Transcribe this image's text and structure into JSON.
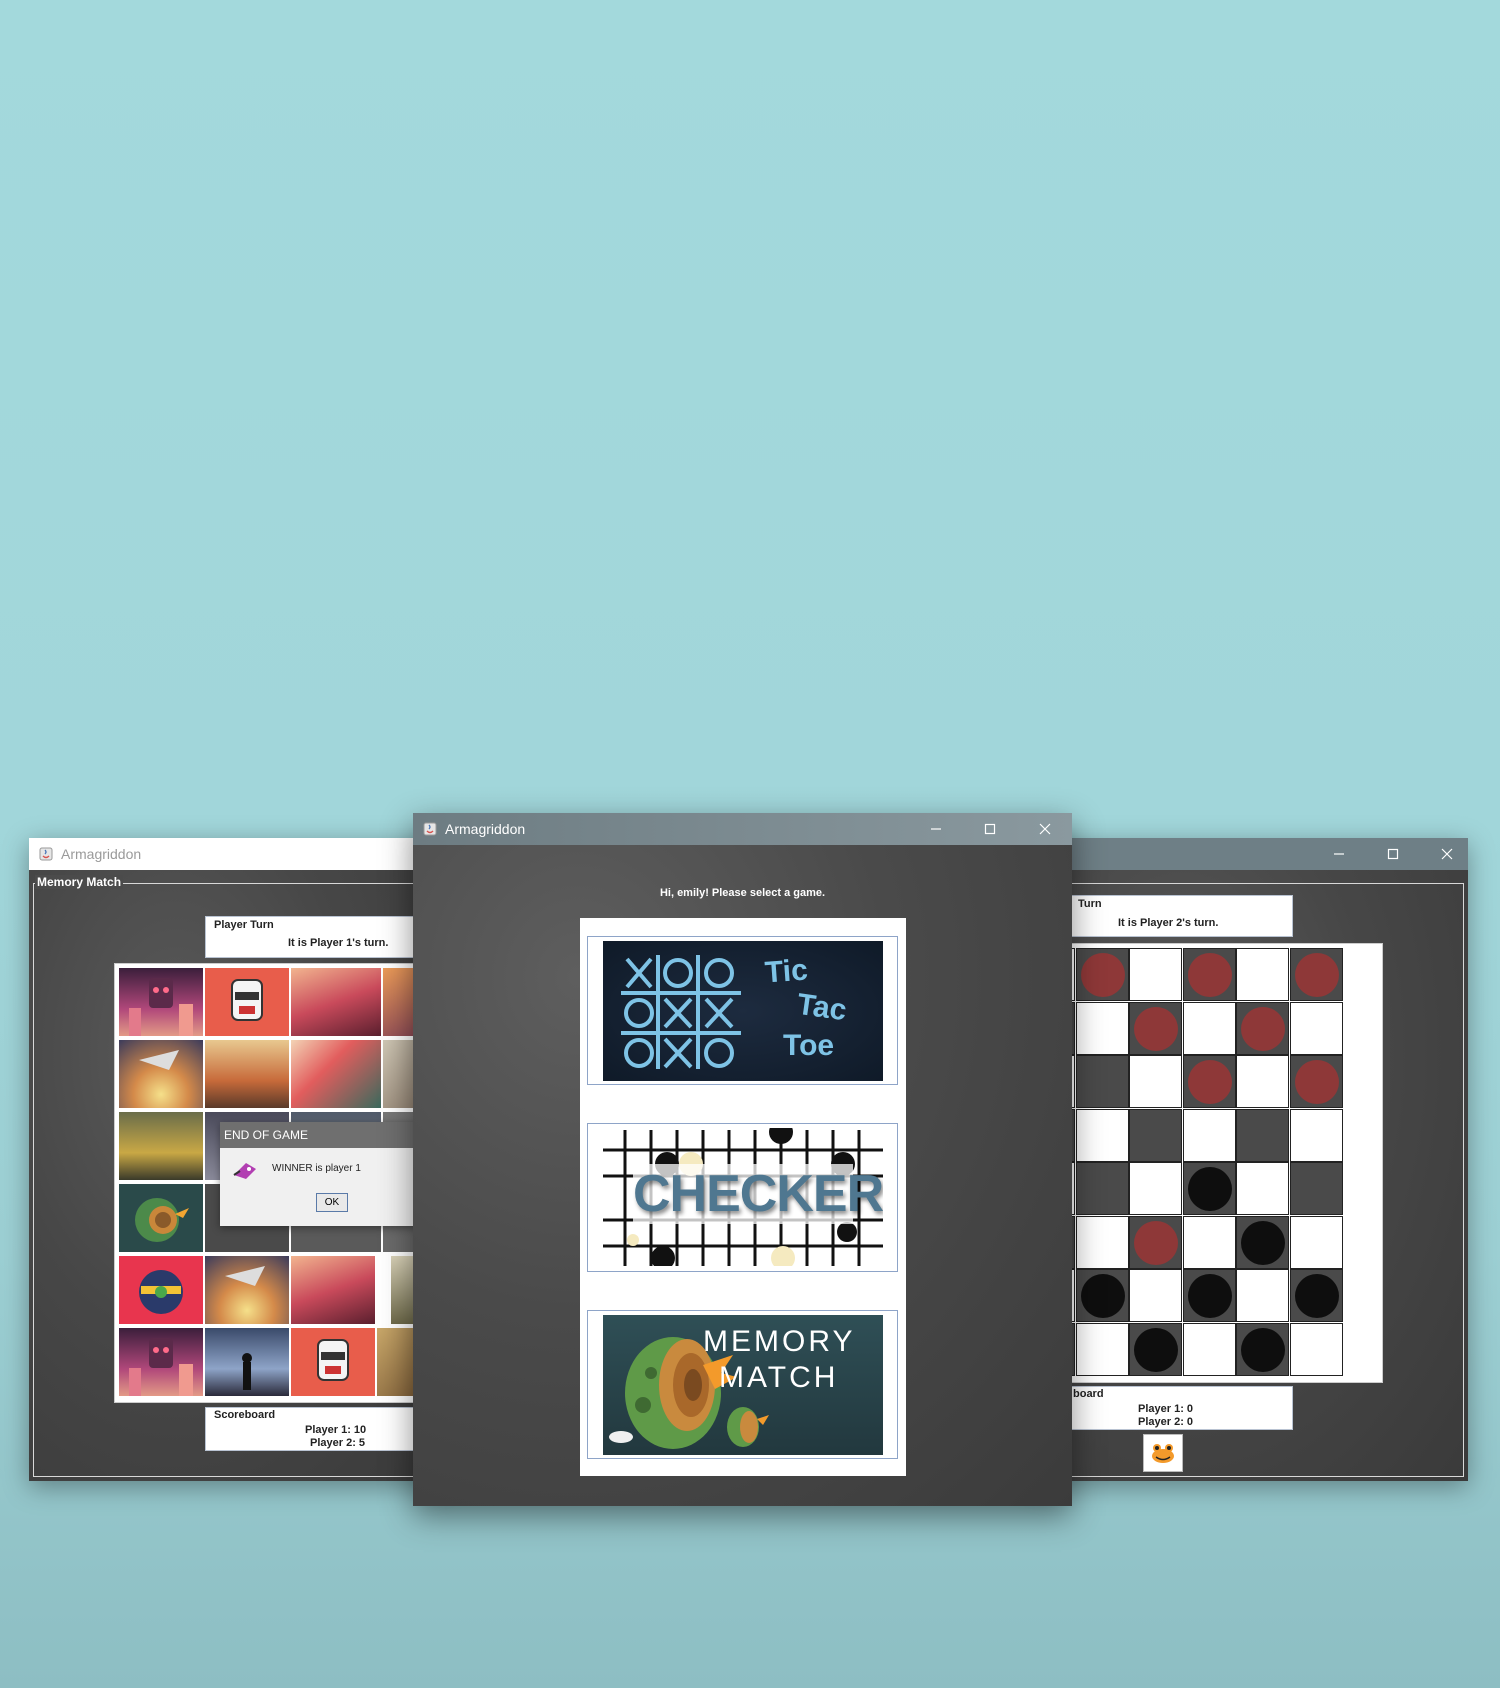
{
  "left_window": {
    "title": "Armagriddon",
    "group_title": "Memory Match",
    "turn_group_label": "Player Turn",
    "turn_text": "It is Player 1's turn.",
    "score_group_label": "Scoreboard",
    "score_p1": "Player 1: 10",
    "score_p2": "Player 2: 5",
    "dialog": {
      "title": "END OF GAME",
      "message": "WINNER is player 1",
      "ok_label": "OK"
    }
  },
  "center_window": {
    "title": "Armagriddon",
    "greeting": "Hi, emily! Please select a game.",
    "games": [
      {
        "name": "Tic Tac Toe",
        "words": [
          "Tic",
          "Tac",
          "Toe"
        ]
      },
      {
        "name": "CHECKERS"
      },
      {
        "name": "Memory Match",
        "line1": "MEMORY",
        "line2": "MATCH"
      }
    ]
  },
  "right_window": {
    "turn_group_label": "Turn",
    "turn_text": "It is Player 2's turn.",
    "score_group_label": "board",
    "score_p1": "Player 1: 0",
    "score_p2": "Player 2: 0"
  },
  "colors": {
    "background_top": "#a3d9dc",
    "window_client": "#474747",
    "red_piece": "#8e3838",
    "black_piece": "#0e0e0e",
    "tictactoe_accent": "#7ec3e6",
    "checkers_text": "#4f7790"
  }
}
